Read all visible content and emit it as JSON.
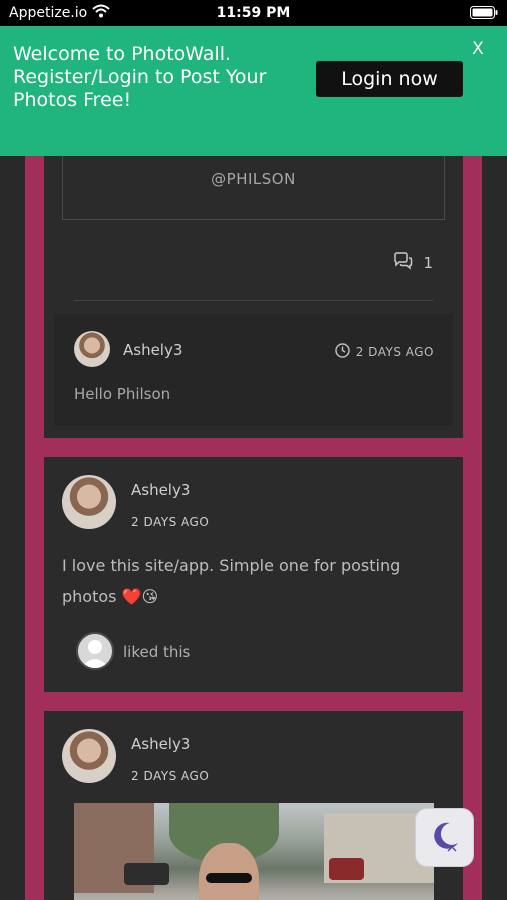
{
  "status_bar": {
    "carrier": "Appetize.io",
    "time": "11:59 PM"
  },
  "banner": {
    "message": "Welcome to PhotoWall. Register/Login to Post Your Photos Free!",
    "login_label": "Login now",
    "close_label": "X",
    "color": "#1fb57c"
  },
  "post_top": {
    "tag": "@PHILSON",
    "comment_count": "1",
    "comment": {
      "username": "Ashely3",
      "time": "2 DAYS AGO",
      "text": "Hello Philson"
    }
  },
  "post_text": {
    "username": "Ashely3",
    "time": "2 DAYS AGO",
    "text": "I love this site/app. Simple one for posting photos",
    "emojis": [
      "❤️",
      "😘"
    ],
    "liked_text": "liked this"
  },
  "post_photo": {
    "username": "Ashely3",
    "time": "2 DAYS AGO"
  },
  "fab": {
    "icon": "moon-icon"
  },
  "colors": {
    "background": "#292929",
    "card": "#2b2b2b",
    "accent_frame": "#a22e5a"
  }
}
